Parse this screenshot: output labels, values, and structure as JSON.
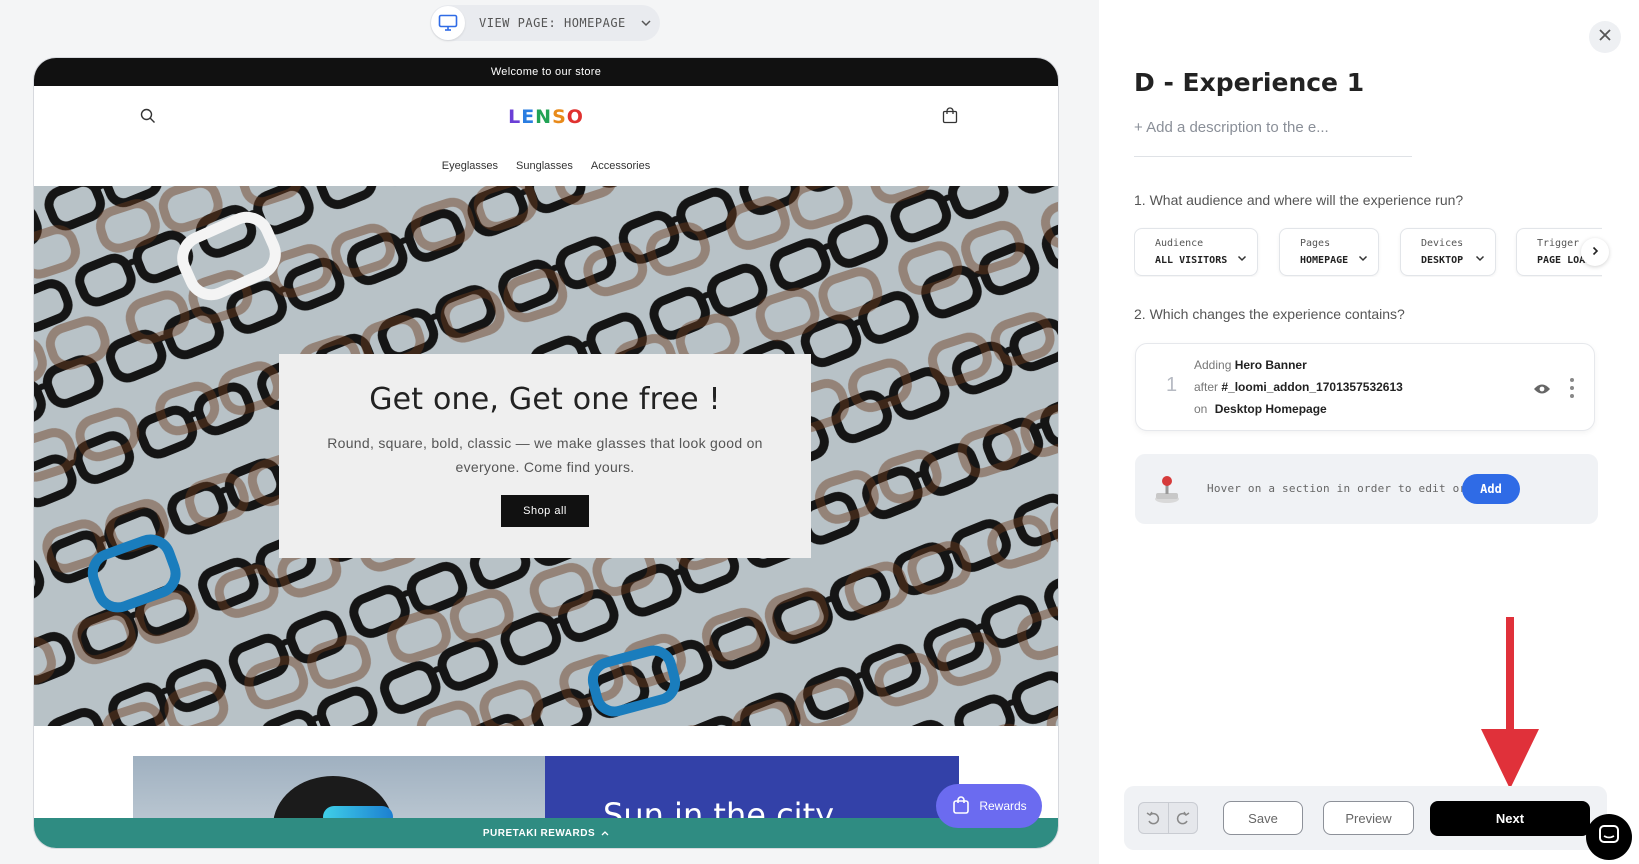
{
  "preview": {
    "view_page_label": "VIEW PAGE: HOMEPAGE",
    "store": {
      "announcement": "Welcome to our store",
      "logo_letters": [
        "L",
        "E",
        "N",
        "S",
        "O"
      ],
      "logo_colors": [
        "#6b3fd6",
        "#2a7de1",
        "#22a355",
        "#e88a1a",
        "#e0312f"
      ],
      "nav": [
        "Eyeglasses",
        "Sunglasses",
        "Accessories"
      ],
      "hero": {
        "title": "Get one, Get one free !",
        "text": "Round, square, bold, classic — we make glasses that look good on everyone. Come find yours.",
        "button": "Shop all"
      },
      "promo_title": "Sun in the city",
      "rewards_bar": "PURETAKI REWARDS",
      "rewards_button": "Rewards"
    }
  },
  "panel": {
    "title": "D - Experience 1",
    "description_placeholder": "+ Add a description to the e...",
    "q1": "1. What audience and where will the experience run?",
    "chips": [
      {
        "label": "Audience",
        "value": "ALL VISITORS"
      },
      {
        "label": "Pages",
        "value": "HOMEPAGE"
      },
      {
        "label": "Devices",
        "value": "DESKTOP"
      },
      {
        "label": "Trigger",
        "value": "PAGE LOAD"
      }
    ],
    "q2": "2. Which changes the experience contains?",
    "change": {
      "index": "1",
      "action": "Adding",
      "component": "Hero Banner",
      "position_word": "after",
      "anchor": "#_loomi_addon_1701357532613",
      "on_word": "on",
      "target": "Desktop Homepage"
    },
    "hover_message": "Hover on a section in order to edit or",
    "add_button": "Add",
    "footer": {
      "save": "Save",
      "preview": "Preview",
      "next": "Next"
    }
  },
  "colors": {
    "primary_blue": "#2f6be6",
    "annotation_red": "#e0313a",
    "rewards_teal": "#2f8c82",
    "rewards_purple": "#6b6bf0"
  }
}
